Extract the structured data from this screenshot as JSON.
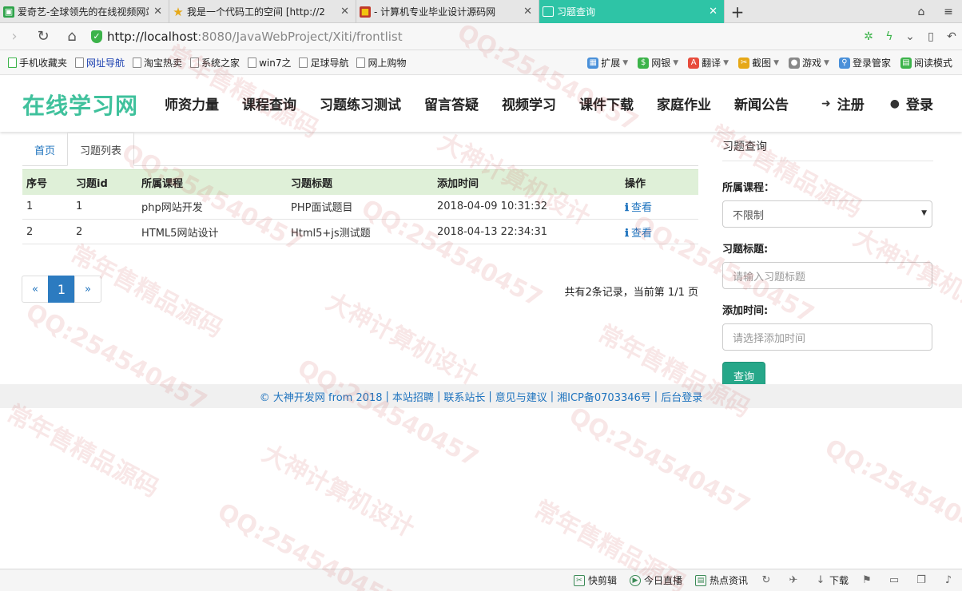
{
  "browser": {
    "tabs": [
      {
        "title": "爱奇艺-全球领先的在线视频网站",
        "icon": "iqiyi-icon",
        "color": "#2ea34a"
      },
      {
        "title": "我是一个代码工的空间 [http://2",
        "icon": "star-icon",
        "color": "#e6a817"
      },
      {
        "title": "- 计算机专业毕业设计源码网",
        "icon": "site-icon",
        "color": "#c0392b"
      },
      {
        "title": "习题查询",
        "icon": "page-icon",
        "color": "#ffffff"
      }
    ],
    "url_host": "http://localhost",
    "url_path": ":8080/JavaWebProject/Xiti/frontlist",
    "bookmarks": [
      "手机收藏夹",
      "网址导航",
      "淘宝热卖",
      "系统之家",
      "win7之",
      "足球导航",
      "网上购物"
    ],
    "bookmarks_right": [
      "扩展",
      "网银",
      "翻译",
      "截图",
      "游戏",
      "登录管家",
      "阅读模式"
    ]
  },
  "site": {
    "logo": "在线学习网",
    "nav": [
      "师资力量",
      "课程查询",
      "习题练习测试",
      "留言答疑",
      "视频学习",
      "课件下载",
      "家庭作业",
      "新闻公告"
    ],
    "register": "注册",
    "login": "登录"
  },
  "breadcrumb": {
    "home": "首页",
    "current": "习题列表"
  },
  "table": {
    "headers": [
      "序号",
      "习题id",
      "所属课程",
      "习题标题",
      "添加时间",
      "操作"
    ],
    "rows": [
      {
        "no": "1",
        "id": "1",
        "course": "php网站开发",
        "title": "PHP面试题目",
        "time": "2018-04-09 10:31:32",
        "action": "查看"
      },
      {
        "no": "2",
        "id": "2",
        "course": "HTML5网站设计",
        "title": "Html5+js测试题",
        "time": "2018-04-13 22:34:31",
        "action": "查看"
      }
    ]
  },
  "pagination": {
    "prev": "«",
    "current": "1",
    "next": "»",
    "summary": "共有2条记录，当前第 1/1 页"
  },
  "search": {
    "title": "习题查询",
    "course_label": "所属课程：",
    "course_value": "不限制",
    "title_label": "习题标题:",
    "title_placeholder": "请输入习题标题",
    "time_label": "添加时间:",
    "time_placeholder": "请选择添加时间",
    "submit": "查询"
  },
  "footer": {
    "links": [
      "© 大神开发网 from 2018",
      "本站招聘",
      "联系站长",
      "意见与建议",
      "湘ICP备0703346号",
      "后台登录"
    ]
  },
  "statusbar": {
    "items": [
      "快剪辑",
      "今日直播",
      "热点资讯",
      "下载"
    ]
  },
  "watermark": {
    "texts": [
      "QQ:254540457",
      "大神计算机设计",
      "常年售精品源码"
    ]
  }
}
